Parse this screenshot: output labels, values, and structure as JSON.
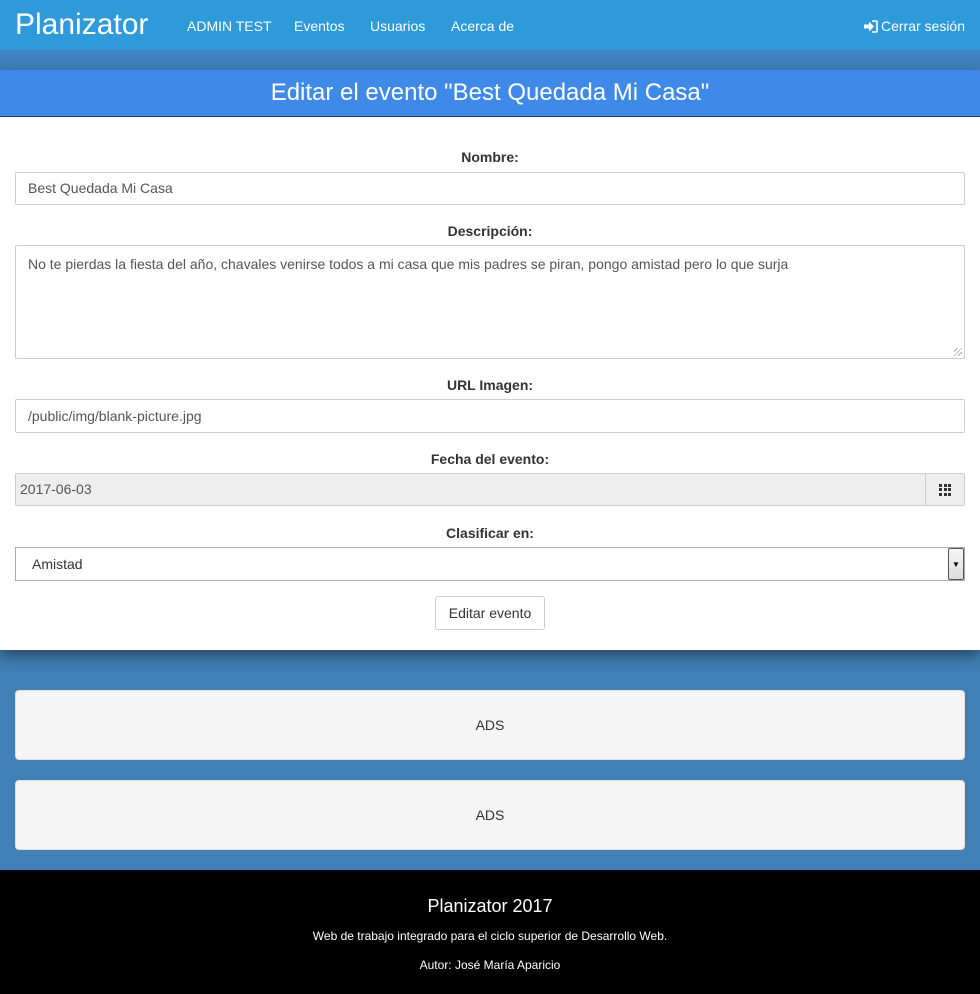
{
  "navbar": {
    "brand": "Planizator",
    "links": [
      "ADMIN TEST",
      "Eventos",
      "Usuarios",
      "Acerca de"
    ],
    "logout_label": "Cerrar sesión",
    "logout_icon": "sign-in-icon"
  },
  "form": {
    "title": "Editar el evento \"Best Quedada Mi Casa\"",
    "nombre_label": "Nombre:",
    "nombre_value": "Best Quedada Mi Casa",
    "descripcion_label": "Descripción:",
    "descripcion_value": "No te pierdas la fiesta del año, chavales venirse todos a mi casa que mis padres se piran, pongo amistad pero lo que surja",
    "url_label": "URL Imagen:",
    "url_value": "/public/img/blank-picture.jpg",
    "fecha_label": "Fecha del evento:",
    "fecha_value": "2017-06-03",
    "clasificar_label": "Clasificar en:",
    "clasificar_value": "Amistad",
    "submit_label": "Editar evento"
  },
  "ads": [
    "ADS",
    "ADS"
  ],
  "footer": {
    "title": "Planizator 2017",
    "description": "Web de trabajo integrado para el ciclo superior de Desarrollo Web.",
    "author": "Autor: José María Aparicio"
  },
  "colors": {
    "navbar": "#2e9ad9",
    "panel_header": "#3f8ae8",
    "background": "#4080b6",
    "footer": "#000000"
  }
}
